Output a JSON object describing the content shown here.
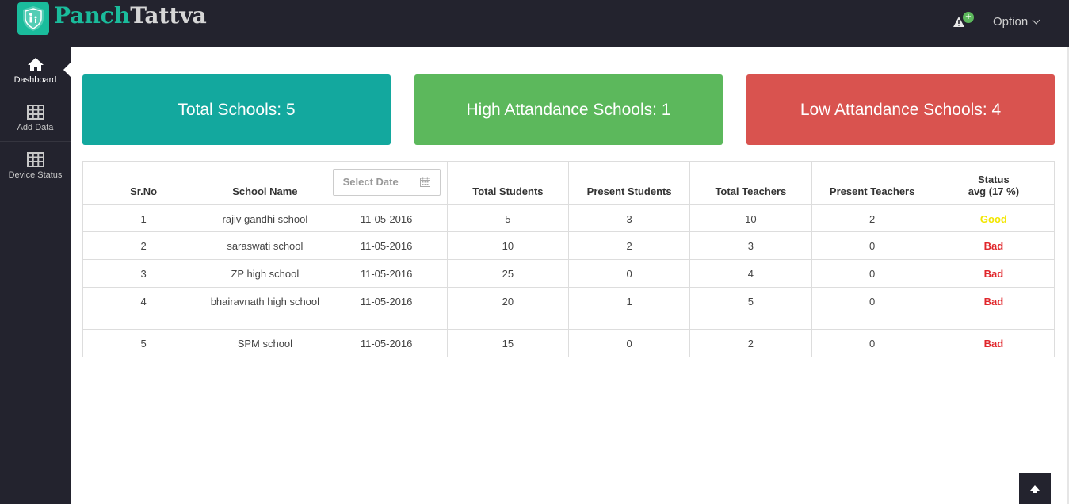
{
  "brand": {
    "part1": "Panch",
    "part2": "Tattva"
  },
  "header": {
    "option_label": "Option",
    "alert_badge": "+"
  },
  "sidebar": {
    "items": [
      {
        "label": "Dashboard",
        "icon": "home-icon",
        "active": true
      },
      {
        "label": "Add Data",
        "icon": "table-grid-icon",
        "active": false
      },
      {
        "label": "Device Status",
        "icon": "table-grid-icon",
        "active": false
      }
    ]
  },
  "cards": {
    "total": "Total Schools: 5",
    "high": "High Attandance Schools: 1",
    "low": "Low Attandance Schools: 4"
  },
  "table": {
    "headers": {
      "srno": "Sr.No",
      "school": "School Name",
      "date_placeholder": "Select Date",
      "total_students": "Total Students",
      "present_students": "Present Students",
      "total_teachers": "Total Teachers",
      "present_teachers": "Present Teachers",
      "status_line1": "Status",
      "status_line2": "avg (17 %)"
    },
    "rows": [
      {
        "srno": "1",
        "school": "rajiv gandhi school",
        "date": "11-05-2016",
        "total_students": "5",
        "present_students": "3",
        "total_teachers": "10",
        "present_teachers": "2",
        "status": "Good"
      },
      {
        "srno": "2",
        "school": "saraswati school",
        "date": "11-05-2016",
        "total_students": "10",
        "present_students": "2",
        "total_teachers": "3",
        "present_teachers": "0",
        "status": "Bad"
      },
      {
        "srno": "3",
        "school": "ZP high school",
        "date": "11-05-2016",
        "total_students": "25",
        "present_students": "0",
        "total_teachers": "4",
        "present_teachers": "0",
        "status": "Bad"
      },
      {
        "srno": "4",
        "school": "bhairavnath high school",
        "date": "11-05-2016",
        "total_students": "20",
        "present_students": "1",
        "total_teachers": "5",
        "present_teachers": "0",
        "status": "Bad"
      },
      {
        "srno": "5",
        "school": "SPM school",
        "date": "11-05-2016",
        "total_students": "15",
        "present_students": "0",
        "total_teachers": "2",
        "present_teachers": "0",
        "status": "Bad"
      }
    ]
  },
  "colors": {
    "navbar": "#23232e",
    "teal": "#13a89e",
    "green": "#5cb85c",
    "red": "#d9534f",
    "status_good": "#f2e600",
    "status_bad": "#e0262b"
  }
}
